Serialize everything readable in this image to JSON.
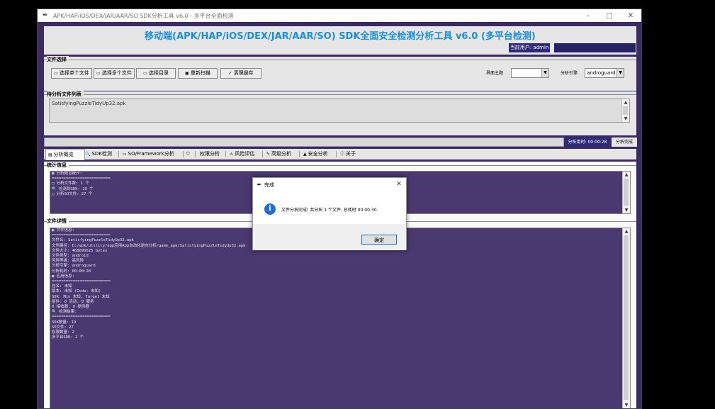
{
  "window": {
    "title": "APK/HAP/iOS/DEX/JAR/AAR/SO SDK分析工具 v6.0 - 多平台全面检测",
    "minimize": "–",
    "maximize": "□",
    "close": "✕"
  },
  "header": {
    "title": "移动端(APK/HAP/iOS/DEX/JAR/AAR/SO) SDK全面安全检测分析工具 v6.0 (多平台检测)",
    "current_user": "当前用户: admin",
    "user_box": ""
  },
  "file_select": {
    "label": "文件选择",
    "buttons": [
      {
        "label": "选择单个文件"
      },
      {
        "label": "选择多个文件"
      },
      {
        "label": "选择目录"
      },
      {
        "label": "重新扫描"
      },
      {
        "label": "清理缓存"
      }
    ],
    "theme_label": "界面主题",
    "theme_value": "",
    "engine_label": "分析引擎",
    "engine_value": "androguard"
  },
  "file_list": {
    "label": "待分析文件列表",
    "items": [
      "SatisfyingPuzzleTidyUp32.apk"
    ]
  },
  "status_bar": {
    "timer": "分析用时: 00:00:28",
    "status": "分析完成"
  },
  "tabs": [
    {
      "label": "分析概览"
    },
    {
      "label": "SDK检测"
    },
    {
      "label": "SO/Framework分析"
    },
    {
      "label": ""
    },
    {
      "label": "权限分析"
    },
    {
      "label": "风险评估"
    },
    {
      "label": "高级分析"
    },
    {
      "label": "安全分析"
    },
    {
      "label": "关于"
    }
  ],
  "stats": {
    "label": "统计信息",
    "lines": [
      "",
      "▣ 分析概览统计:",
      "=========================",
      "□ 分析文件数: 1 个",
      "🔍 检测到SDK: 19 个",
      "□ 分析SO文件: 27 个"
    ]
  },
  "details": {
    "label": "文件详情",
    "lines": [
      "",
      "▣ 文件信息:",
      "=========================",
      "文件名: SatisfyingPuzzleTidyUp32.apk",
      "文件路径: D:/apk/utility/app应用App自动化逆向分析/game_apk/SatisfyingPuzzleTidyUp32.apk",
      "文件大小: 468895625 bytes",
      "文件类型: android",
      "风险等级: 高风险",
      "分析引擎: androguard",
      "分析耗时: 00:00:28",
      "",
      "",
      "▣ 应用信息:",
      "=========================",
      "包名: 未知",
      "版本: 未知 (Code: 未知)",
      "SDK: Min 未知, Target 未知",
      "组件: 0 活动, 0 服务",
      "      0 接收器, 0 提供器",
      "",
      "",
      "🔍 检测结果:",
      "=========================",
      "SDK数量: 19",
      "SO文件: 27",
      "权限数量: 2",
      "多平台SDK: 2 个"
    ]
  },
  "dialog": {
    "title": "完成",
    "close": "✕",
    "icon": "info-icon",
    "message": "文件分析完成! 共分析 1 个文件, 总耗时 00:00:30.",
    "ok": "确定"
  }
}
